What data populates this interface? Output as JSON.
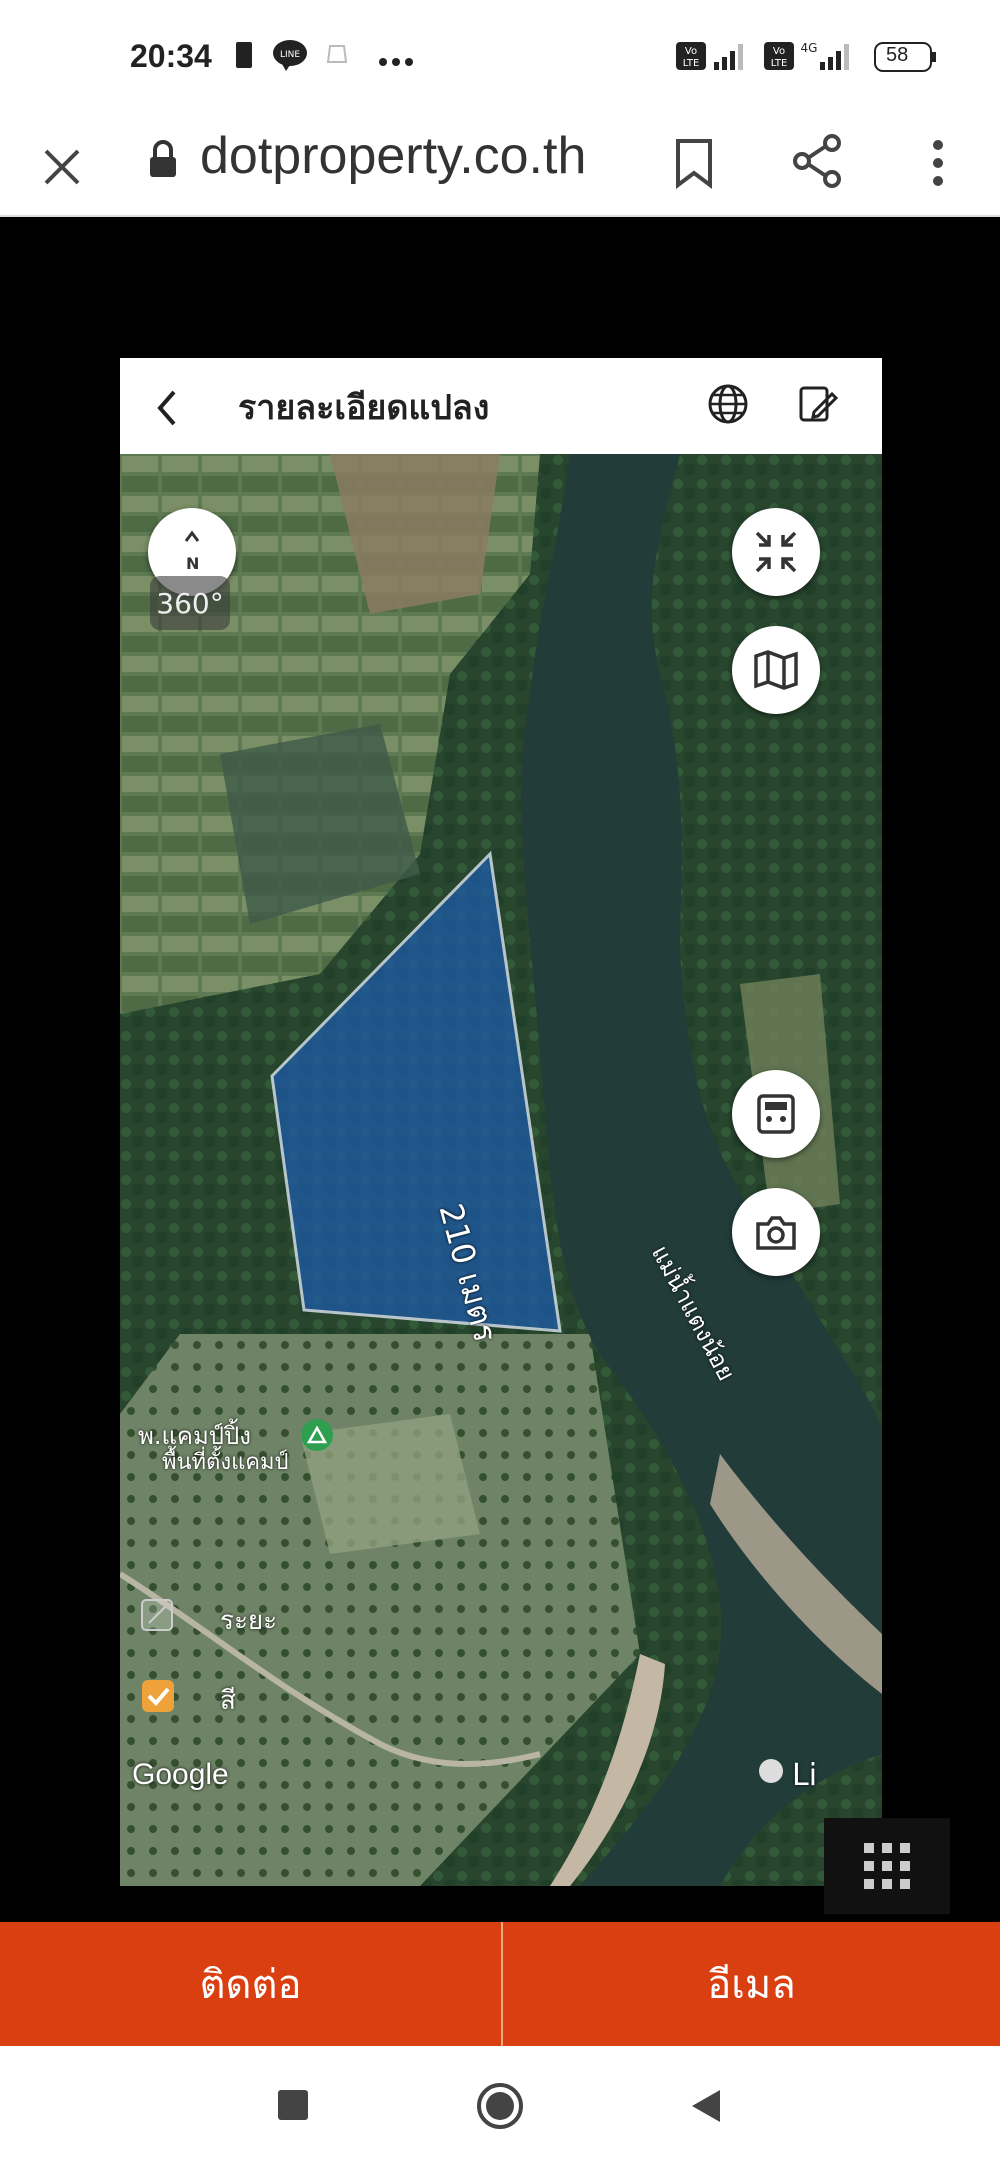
{
  "status": {
    "time": "20:34",
    "battery": "58",
    "network": "4G"
  },
  "browser": {
    "url": "dotproperty.co.th"
  },
  "card": {
    "title": "รายละเอียดแปลง",
    "compass_label": "N",
    "view_360": "360°",
    "plot_length": "210 เมตร",
    "river_label": "แม่น้ำแตงน้อย",
    "place_label": "พ.แคมป์ปิ้ง",
    "place_sublabel": "พื้นที่ตั้งแคมป์",
    "distance_label": "ระยะ",
    "checkbox_label": "สี",
    "map_attribution": "Google",
    "map_attribution_right": "Li"
  },
  "actions": {
    "contact": "ติดต่อ",
    "email": "อีเมล"
  },
  "colors": {
    "accent": "#d93f10",
    "plot_fill": "#1e5aa8"
  }
}
